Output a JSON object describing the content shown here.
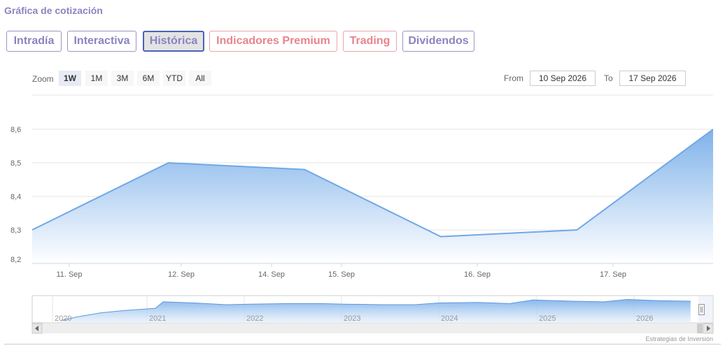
{
  "header": {
    "title": "Gráfica de cotización"
  },
  "tabs": [
    {
      "label": "Intradía",
      "active": false,
      "tone": "purple"
    },
    {
      "label": "Interactiva",
      "active": false,
      "tone": "purple"
    },
    {
      "label": "Histórica",
      "active": true,
      "tone": "purple"
    },
    {
      "label": "Indicadores Premium",
      "active": false,
      "tone": "red"
    },
    {
      "label": "Trading",
      "active": false,
      "tone": "red"
    },
    {
      "label": "Dividendos",
      "active": false,
      "tone": "purple"
    }
  ],
  "rangeselector": {
    "zoom_label": "Zoom",
    "buttons": [
      "1W",
      "1M",
      "3M",
      "6M",
      "YTD",
      "All"
    ],
    "selected": "1W",
    "from_label": "From",
    "from_value": "10 Sep 2026",
    "to_label": "To",
    "to_value": "17 Sep 2026"
  },
  "credits": "Estrategias de Inversión",
  "colors": {
    "line": "#6fa8e6",
    "fill_top": "#7fb2ea",
    "fill_bottom": "#ffffff",
    "grid": "#e6e6e6",
    "tab_text": "#8a84c0",
    "tab_red": "#e8848c"
  },
  "chart_data": {
    "type": "area",
    "title": "",
    "xlabel": "",
    "ylabel": "",
    "ylim": [
      8.2,
      8.6
    ],
    "yticks": [
      "8,2",
      "8,3",
      "8,4",
      "8,5",
      "8,6"
    ],
    "xticks": [
      "11. Sep",
      "12. Sep",
      "14. Sep",
      "15. Sep",
      "16. Sep",
      "17. Sep"
    ],
    "grid": true,
    "legend": "none",
    "series": [
      {
        "x": [
          "2026-09-10",
          "2026-09-11",
          "2026-09-14",
          "2026-09-15",
          "2026-09-16",
          "2026-09-17"
        ],
        "y": [
          8.3,
          8.5,
          8.48,
          8.28,
          8.3,
          8.6
        ]
      }
    ],
    "navigator": {
      "type": "area",
      "xticks": [
        "2020",
        "2021",
        "2022",
        "2023",
        "2024",
        "2025",
        "2026"
      ],
      "series": [
        {
          "x": [
            "2020-01",
            "2020-03",
            "2020-06",
            "2020-09",
            "2021-01",
            "2021-02",
            "2021-06",
            "2021-10",
            "2022-01",
            "2022-06",
            "2022-10",
            "2023-01",
            "2023-06",
            "2023-10",
            "2024-01",
            "2024-06",
            "2024-10",
            "2025-01",
            "2025-06",
            "2025-10",
            "2026-01",
            "2026-05",
            "2026-09"
          ],
          "y": [
            5.0,
            5.6,
            6.3,
            6.7,
            7.1,
            8.2,
            8.0,
            7.7,
            7.8,
            7.9,
            7.9,
            7.8,
            7.7,
            7.7,
            8.0,
            8.1,
            7.9,
            8.5,
            8.3,
            8.2,
            8.6,
            8.4,
            8.3
          ]
        }
      ]
    }
  }
}
